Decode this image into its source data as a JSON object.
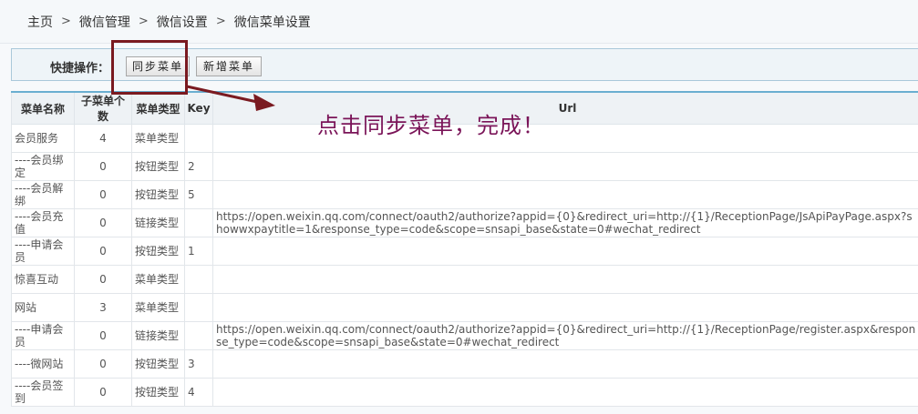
{
  "breadcrumb": {
    "items": [
      "主页",
      "微信管理",
      "微信设置",
      "微信菜单设置"
    ],
    "separator": ">"
  },
  "quick_ops": {
    "label": "快捷操作：",
    "sync_button": "同步菜单",
    "add_button": "新增菜单"
  },
  "annotation": {
    "text": "点击同步菜单，完成！",
    "color": "#7a1458",
    "box_color": "#7a1a20"
  },
  "table": {
    "headers": {
      "name": "菜单名称",
      "count": "子菜单个数",
      "type": "菜单类型",
      "key": "Key",
      "url": "Url"
    },
    "rows": [
      {
        "name": "会员服务",
        "count": "4",
        "type": "菜单类型",
        "key": "",
        "url": ""
      },
      {
        "name": "----会员绑定",
        "count": "0",
        "type": "按钮类型",
        "key": "2",
        "url": ""
      },
      {
        "name": "----会员解绑",
        "count": "0",
        "type": "按钮类型",
        "key": "5",
        "url": ""
      },
      {
        "name": "----会员充值",
        "count": "0",
        "type": "链接类型",
        "key": "",
        "url": "https://open.weixin.qq.com/connect/oauth2/authorize?appid={0}&redirect_uri=http://{1}/ReceptionPage/JsApiPayPage.aspx?showwxpaytitle=1&response_type=code&scope=snsapi_base&state=0#wechat_redirect"
      },
      {
        "name": "----申请会员",
        "count": "0",
        "type": "按钮类型",
        "key": "1",
        "url": ""
      },
      {
        "name": "惊喜互动",
        "count": "0",
        "type": "菜单类型",
        "key": "",
        "url": ""
      },
      {
        "name": "网站",
        "count": "3",
        "type": "菜单类型",
        "key": "",
        "url": ""
      },
      {
        "name": "----申请会员",
        "count": "0",
        "type": "链接类型",
        "key": "",
        "url": "https://open.weixin.qq.com/connect/oauth2/authorize?appid={0}&redirect_uri=http://{1}/ReceptionPage/register.aspx&response_type=code&scope=snsapi_base&state=0#wechat_redirect"
      },
      {
        "name": "----微网站",
        "count": "0",
        "type": "按钮类型",
        "key": "3",
        "url": ""
      },
      {
        "name": "----会员签到",
        "count": "0",
        "type": "按钮类型",
        "key": "4",
        "url": ""
      }
    ]
  }
}
